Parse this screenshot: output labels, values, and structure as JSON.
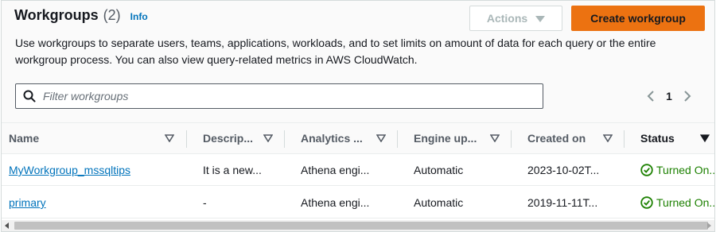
{
  "header": {
    "title": "Workgroups",
    "count": "(2)",
    "info": "Info",
    "actions_label": "Actions",
    "create_label": "Create workgroup",
    "description": "Use workgroups to separate users, teams, applications, workloads, and to set limits on amount of data for each query or the entire workgroup process. You can also view query-related metrics in AWS CloudWatch."
  },
  "filter": {
    "placeholder": "Filter workgroups",
    "value": ""
  },
  "pagination": {
    "current_page": "1"
  },
  "table": {
    "columns": [
      "Name",
      "Descrip...",
      "Analytics ...",
      "Engine up...",
      "Created on",
      "Status"
    ],
    "rows": [
      {
        "name": "MyWorkgroup_mssqltips",
        "description": "It is a new...",
        "analytics": "Athena engi...",
        "engine_update": "Automatic",
        "created_on": "2023-10-02T...",
        "status": "Turned On..."
      },
      {
        "name": "primary",
        "description": "-",
        "analytics": "Athena engi...",
        "engine_update": "Automatic",
        "created_on": "2019-11-11T...",
        "status": "Turned On..."
      }
    ]
  },
  "icons": {
    "search": "search-icon",
    "sort": "sort-caret-icon",
    "status": "check-circle-icon",
    "prev": "chevron-left-icon",
    "next": "chevron-right-icon"
  },
  "colors": {
    "primary_button": "#ec7211",
    "link": "#0073bb",
    "success": "#1d8102"
  }
}
